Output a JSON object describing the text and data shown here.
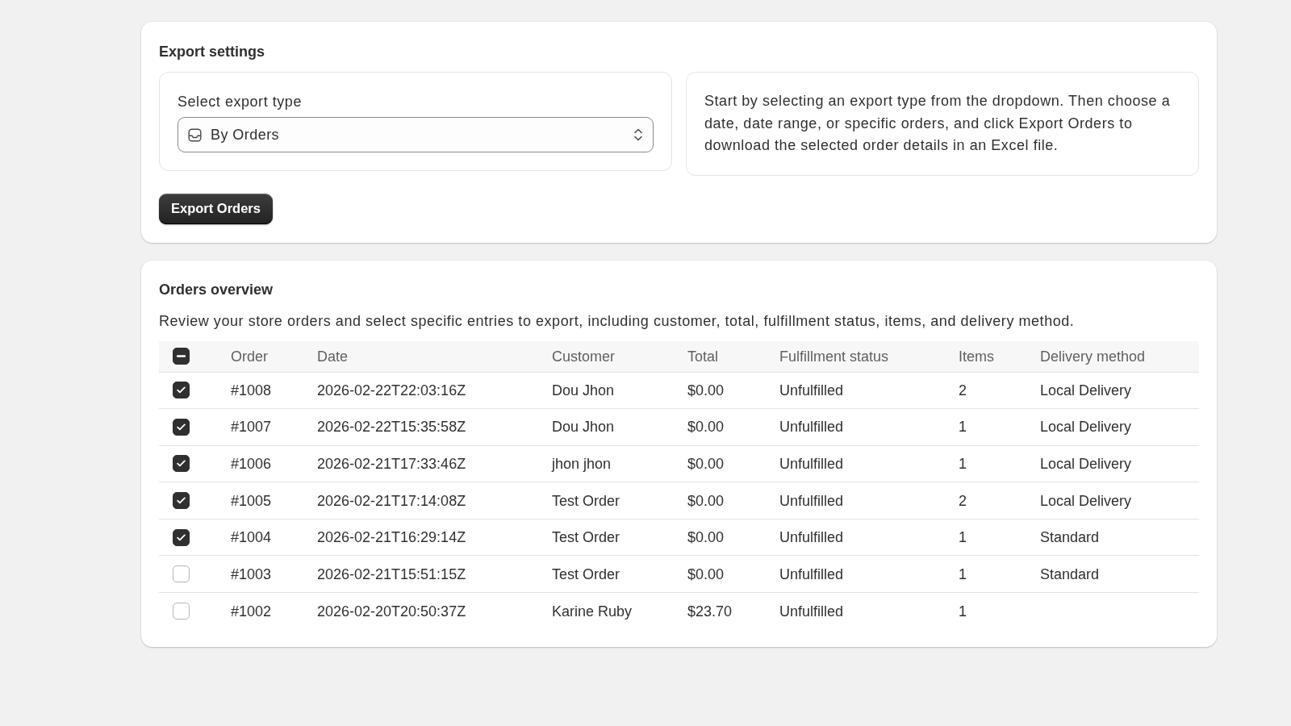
{
  "export_settings": {
    "title": "Export settings",
    "field_label": "Select export type",
    "select": {
      "value": "By Orders"
    },
    "help_text": "Start by selecting an export type from the dropdown. Then choose a date, date range, or specific orders, and click Export Orders to download the selected order details in an Excel file.",
    "button": "Export Orders"
  },
  "orders_overview": {
    "title": "Orders overview",
    "description": "Review your store orders and select specific entries to export, including customer, total, fulfillment status, items, and delivery method.",
    "table": {
      "select_all": {
        "indeterminate": true
      },
      "columns": [
        "Order",
        "Date",
        "Customer",
        "Total",
        "Fulfillment status",
        "Items",
        "Delivery method"
      ],
      "rows": [
        {
          "selected": true,
          "order": "#1008",
          "date": "2026-02-22T22:03:16Z",
          "customer": "Dou Jhon",
          "total": "$0.00",
          "fulfillment_status": "Unfulfilled",
          "items": "2",
          "delivery_method": "Local Delivery"
        },
        {
          "selected": true,
          "order": "#1007",
          "date": "2026-02-22T15:35:58Z",
          "customer": "Dou Jhon",
          "total": "$0.00",
          "fulfillment_status": "Unfulfilled",
          "items": "1",
          "delivery_method": "Local Delivery"
        },
        {
          "selected": true,
          "order": "#1006",
          "date": "2026-02-21T17:33:46Z",
          "customer": "jhon jhon",
          "total": "$0.00",
          "fulfillment_status": "Unfulfilled",
          "items": "1",
          "delivery_method": "Local Delivery"
        },
        {
          "selected": true,
          "order": "#1005",
          "date": "2026-02-21T17:14:08Z",
          "customer": "Test Order",
          "total": "$0.00",
          "fulfillment_status": "Unfulfilled",
          "items": "2",
          "delivery_method": "Local Delivery"
        },
        {
          "selected": true,
          "order": "#1004",
          "date": "2026-02-21T16:29:14Z",
          "customer": "Test Order",
          "total": "$0.00",
          "fulfillment_status": "Unfulfilled",
          "items": "1",
          "delivery_method": "Standard"
        },
        {
          "selected": false,
          "order": "#1003",
          "date": "2026-02-21T15:51:15Z",
          "customer": "Test Order",
          "total": "$0.00",
          "fulfillment_status": "Unfulfilled",
          "items": "1",
          "delivery_method": "Standard"
        },
        {
          "selected": false,
          "order": "#1002",
          "date": "2026-02-20T20:50:37Z",
          "customer": "Karine Ruby",
          "total": "$23.70",
          "fulfillment_status": "Unfulfilled",
          "items": "1"
        }
      ]
    }
  }
}
